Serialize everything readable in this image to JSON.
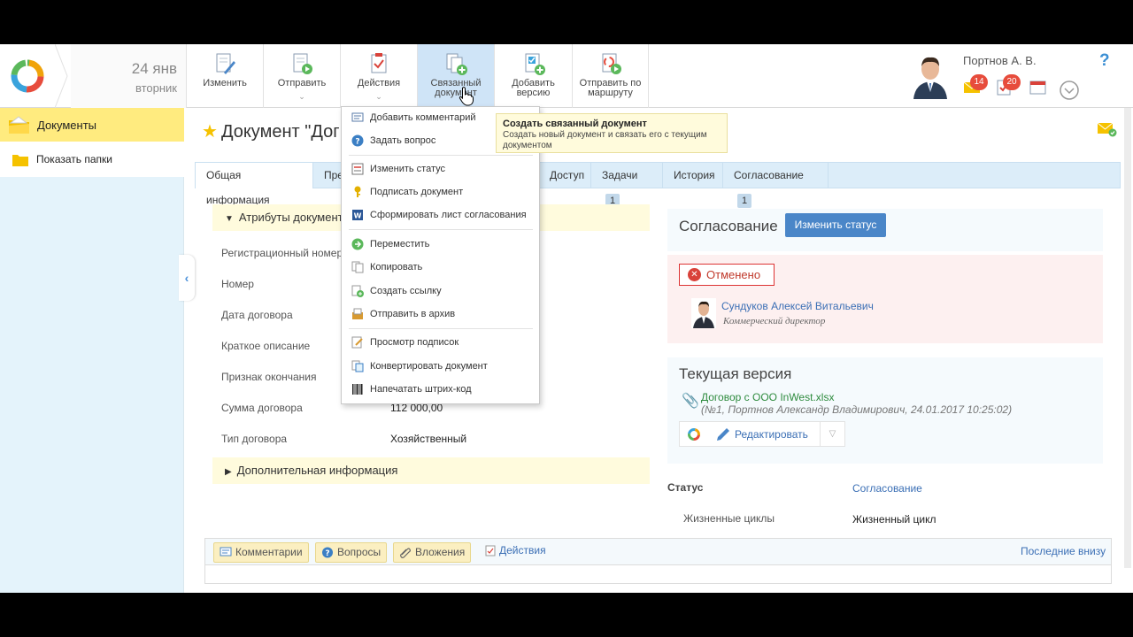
{
  "header": {
    "date_day": "24 янв",
    "date_weekday": "вторник",
    "toolbar": [
      {
        "label": "Изменить",
        "has_menu": false
      },
      {
        "label": "Отправить",
        "has_menu": true
      },
      {
        "label": "Действия",
        "has_menu": true
      },
      {
        "label": "Связанный документ",
        "has_menu": false,
        "active": true
      },
      {
        "label": "Добавить версию",
        "has_menu": false
      },
      {
        "label": "Отправить по маршруту",
        "has_menu": false
      }
    ],
    "user_name": "Портнов А. В.",
    "mail_count": "14",
    "tasks_count": "20",
    "help": "?"
  },
  "sidebar": {
    "documents": "Документы",
    "show_folders": "Показать папки"
  },
  "document": {
    "title": "Документ \"Дог",
    "tabs": [
      {
        "label": "Общая информация",
        "active": true
      },
      {
        "label": "Пре"
      },
      {
        "label": "Доступ"
      },
      {
        "label": "Задачи",
        "count": "1"
      },
      {
        "label": "История"
      },
      {
        "label": "Согласование",
        "count": "1"
      }
    ],
    "attributes_title": "Атрибуты документа",
    "attributes": [
      {
        "label": "Регистрационный номер",
        "value": ""
      },
      {
        "label": "Номер",
        "value": ""
      },
      {
        "label": "Дата договора",
        "value": ""
      },
      {
        "label": "Краткое описание",
        "value": ""
      },
      {
        "label": "Признак окончания",
        "value": ""
      },
      {
        "label": "Сумма договора",
        "value": "112 000,00"
      },
      {
        "label": "Тип договора",
        "value": "Хозяйственный"
      }
    ],
    "extra_title": "Дополнительная информация"
  },
  "approval": {
    "title": "Согласование",
    "change_status": "Изменить статус",
    "state": "Отменено",
    "signer_name": "Сундуков Алексей Витальевич",
    "signer_role": "Коммерческий директор"
  },
  "version": {
    "title": "Текущая версия",
    "file_name": "Договор с ООО InWest.xlsx",
    "file_meta": "(№1, Портнов Александр Владимирович, 24.01.2017 10:25:02)",
    "edit_label": "Редактировать"
  },
  "properties": {
    "status_label": "Статус",
    "status_value": "Согласование",
    "lifecycle_label": "Жизненные циклы",
    "lifecycle_value": "Жизненный цикл"
  },
  "bottom": {
    "comments": "Комментарии",
    "questions": "Вопросы",
    "attachments": "Вложения",
    "actions": "Действия",
    "order": "Последние внизу"
  },
  "actions_menu": {
    "groups": [
      [
        {
          "label": "Добавить комментарий",
          "icon": "comment-icon"
        },
        {
          "label": "Задать вопрос",
          "icon": "question-icon"
        }
      ],
      [
        {
          "label": "Изменить статус",
          "icon": "status-icon"
        },
        {
          "label": "Подписать документ",
          "icon": "key-icon"
        },
        {
          "label": "Сформировать лист согласования",
          "icon": "word-icon"
        }
      ],
      [
        {
          "label": "Переместить",
          "icon": "move-icon"
        },
        {
          "label": "Копировать",
          "icon": "copy-icon"
        },
        {
          "label": "Создать ссылку",
          "icon": "link-icon"
        },
        {
          "label": "Отправить в архив",
          "icon": "archive-icon"
        }
      ],
      [
        {
          "label": "Просмотр подписок",
          "icon": "subscriptions-icon"
        },
        {
          "label": "Конвертировать документ",
          "icon": "convert-icon"
        },
        {
          "label": "Напечатать штрих-код",
          "icon": "barcode-icon"
        }
      ]
    ]
  },
  "tooltip": {
    "title": "Создать связанный документ",
    "text": "Создать новый документ и связать его с текущим документом"
  },
  "colors": {
    "accent": "#4a86c8",
    "sidebar_active": "#ffeb7f",
    "cancel": "#d9423a",
    "badge": "#e74c3c"
  }
}
